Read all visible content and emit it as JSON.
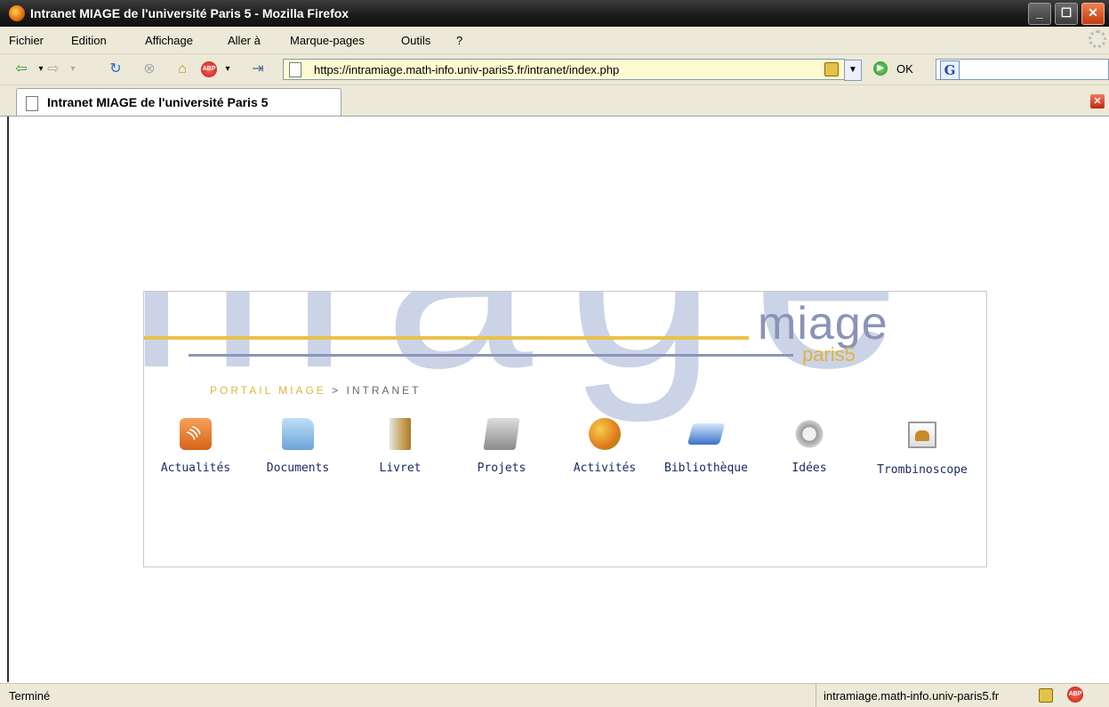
{
  "window": {
    "title": "Intranet MIAGE de l'université Paris 5 - Mozilla Firefox"
  },
  "menu": [
    "Fichier",
    "Edition",
    "Affichage",
    "Aller à",
    "Marque-pages",
    "Outils",
    "?"
  ],
  "navbar": {
    "url": "https://intramiage.math-info.univ-paris5.fr/intranet/index.php",
    "go_label": "OK",
    "search_icon_letter": "G",
    "adblock_label": "ABP"
  },
  "tab": {
    "label": "Intranet MIAGE de l'université Paris 5"
  },
  "page": {
    "logo_text": "miage",
    "logo_sub": "paris5",
    "breadcrumb_portal": "PORTAIL MIAGE",
    "breadcrumb_sep": ">",
    "breadcrumb_current": "INTRANET",
    "items": [
      {
        "label": "Actualités",
        "icon": "rss-icon"
      },
      {
        "label": "Documents",
        "icon": "folder-icon"
      },
      {
        "label": "Livret",
        "icon": "book-icon"
      },
      {
        "label": "Projets",
        "icon": "projects-icon"
      },
      {
        "label": "Activités",
        "icon": "fruit-basket-icon"
      },
      {
        "label": "Bibliothèque",
        "icon": "open-book-icon"
      },
      {
        "label": "Idées",
        "icon": "gears-icon"
      },
      {
        "label": "Trombinoscope",
        "icon": "photo-icon"
      }
    ]
  },
  "status": {
    "text": "Terminé",
    "host": "intramiage.math-info.univ-paris5.fr"
  },
  "colors": {
    "accent_yellow": "#e9c24a",
    "accent_blue": "#8a93b8",
    "link_text": "#1a2a6a"
  }
}
